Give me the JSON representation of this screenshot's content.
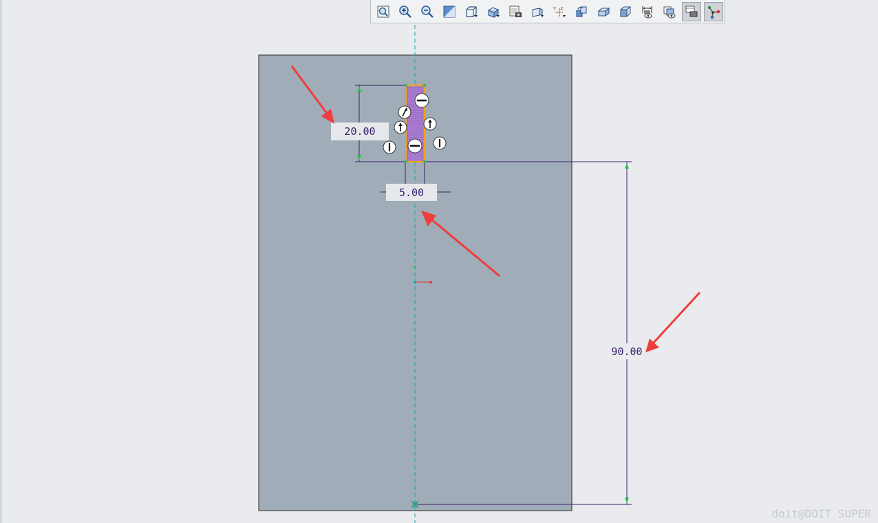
{
  "toolbar": {
    "items": [
      {
        "icon": "zoom-fit-icon"
      },
      {
        "icon": "zoom-in-icon"
      },
      {
        "icon": "zoom-out-icon"
      },
      {
        "icon": "repaint-icon"
      },
      {
        "icon": "display-style-icon"
      },
      {
        "icon": "saved-orientations-icon"
      },
      {
        "icon": "view-manager-icon"
      },
      {
        "icon": "perspective-view-icon"
      },
      {
        "icon": "datum-display-icon"
      },
      {
        "icon": "spin-center-icon"
      },
      {
        "icon": "annotation-display-icon"
      },
      {
        "icon": "sketch-view-icon"
      },
      {
        "icon": "dimension-display-icon"
      },
      {
        "icon": "constraint-display-icon"
      },
      {
        "icon": "grid-display-icon"
      },
      {
        "icon": "vertex-display-icon"
      }
    ]
  },
  "sketch": {
    "dimensions": {
      "height": "20.00",
      "width": "5.00",
      "offset": "90.00"
    },
    "colors": {
      "plate": "#a0acb8",
      "dimension_line": "#3a1f6e",
      "centerline": "#1aa3a8",
      "profile": "#f0a020",
      "profile_fill": "#a77ccf",
      "arrow": "#f03c3c"
    }
  },
  "watermark": "doit@DOIT SUPER"
}
